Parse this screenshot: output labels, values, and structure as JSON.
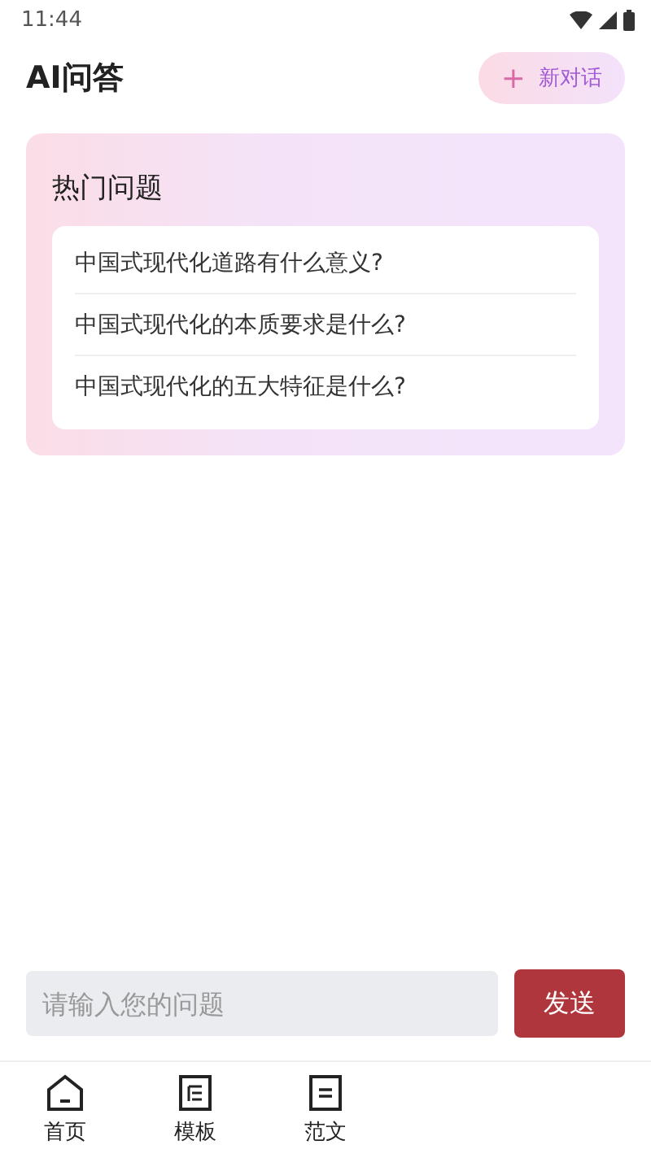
{
  "status_bar": {
    "time": "11:44"
  },
  "header": {
    "title": "AI问答",
    "new_chat_button": {
      "icon": "+",
      "label": "新对话"
    }
  },
  "hot_questions": {
    "title": "热门问题",
    "items": [
      {
        "text": "中国式现代化道路有什么意义?"
      },
      {
        "text": "中国式现代化的本质要求是什么?"
      },
      {
        "text": "中国式现代化的五大特征是什么?"
      }
    ]
  },
  "input": {
    "placeholder": "请输入您的问题",
    "send_button": "发送"
  },
  "bottom_nav": [
    {
      "kind": "home",
      "label": "首页"
    },
    {
      "kind": "template",
      "label": "模板"
    },
    {
      "kind": "essay",
      "label": "范文"
    }
  ]
}
